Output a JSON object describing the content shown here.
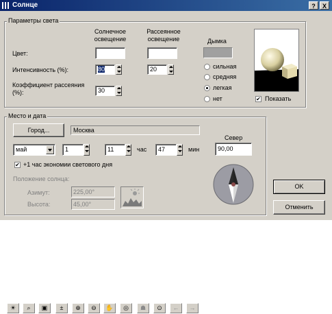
{
  "window": {
    "title": "Солнце",
    "help_label": "?",
    "close_label": "X"
  },
  "light_params": {
    "group_label": "Параметры света",
    "sun_header": "Солнечное освещение",
    "ambient_header": "Рассеянное освещение",
    "haze_header": "Дымка",
    "color_label": "Цвет:",
    "intensity_label": "Интенсивность (%):",
    "intensity_sun": "80",
    "intensity_ambient": "20",
    "scatter_label": "Коэффициент рассеяния (%):",
    "scatter_value": "30",
    "haze_options": [
      "сильная",
      "средняя",
      "легкая",
      "нет"
    ],
    "haze_selected": "легкая",
    "show_label": "Показать",
    "swatch_color": "#a0a0a0"
  },
  "place_date": {
    "group_label": "Место и дата",
    "city_button": "Город...",
    "city_value": "Москва",
    "north_label": "Север",
    "north_value": "90,00",
    "month": "май",
    "day": "1",
    "hour": "11",
    "hour_unit": "час",
    "minute": "47",
    "minute_unit": "мин",
    "dst_label": "+1 час экономии светового дня",
    "sun_position_label": "Положение солнца:",
    "azimuth_label": "Азимут:",
    "azimuth_value": "225,00°",
    "altitude_label": "Высота:",
    "altitude_value": "45,00°"
  },
  "buttons": {
    "ok": "OK",
    "cancel": "Отменить"
  },
  "toolbar": {
    "items": [
      "sun-settings-icon",
      "zoom-window-icon",
      "preview-icon",
      "zoom-toggle-icon",
      "zoom-in-icon",
      "zoom-out-icon",
      "pan-hand-icon",
      "orbit-icon",
      "walk-icon",
      "zoom-extents-icon",
      "previous-view-icon",
      "next-view-icon"
    ]
  }
}
